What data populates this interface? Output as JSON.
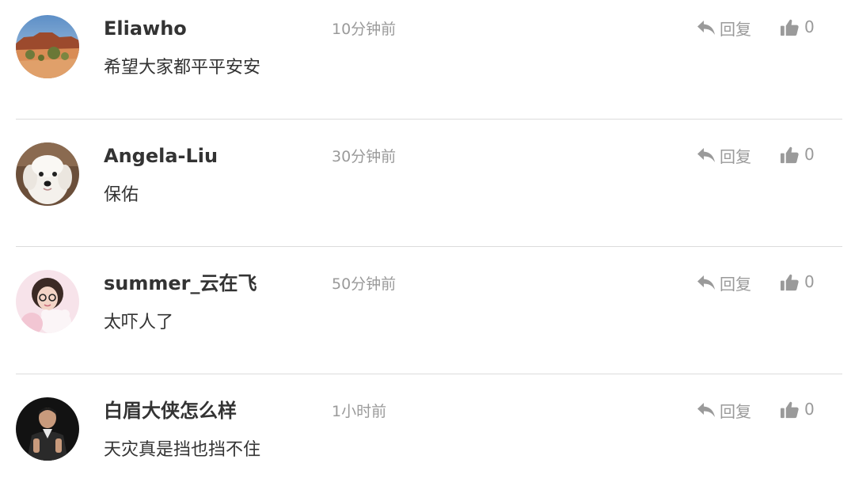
{
  "comments": [
    {
      "username": "Eliawho",
      "time": "10分钟前",
      "content": "希望大家都平平安安",
      "reply_label": "回复",
      "likes": "0",
      "avatar_icon": "landscape-avatar-icon"
    },
    {
      "username": "Angela-Liu",
      "time": "30分钟前",
      "content": "保佑",
      "reply_label": "回复",
      "likes": "0",
      "avatar_icon": "dog-avatar-icon"
    },
    {
      "username": "summer_云在飞",
      "time": "50分钟前",
      "content": "太吓人了",
      "reply_label": "回复",
      "likes": "0",
      "avatar_icon": "girl-avatar-icon"
    },
    {
      "username": "白眉大侠怎么样",
      "time": "1小时前",
      "content": "天灾真是挡也挡不住",
      "reply_label": "回复",
      "likes": "0",
      "avatar_icon": "man-avatar-icon"
    }
  ],
  "icons": {
    "reply": "reply-arrow-icon",
    "like": "thumbs-up-icon"
  },
  "colors": {
    "username": "#333333",
    "meta": "#9a9a9a",
    "divider": "#dcdcdc"
  }
}
